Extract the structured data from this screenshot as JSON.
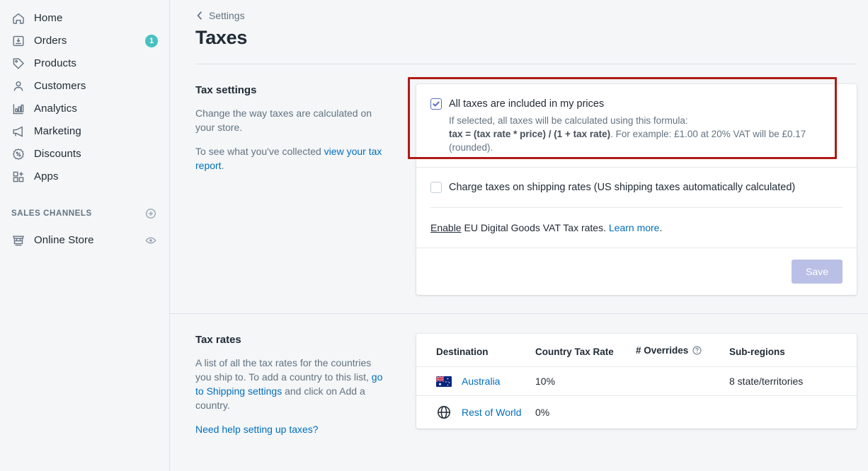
{
  "sidebar": {
    "items": [
      {
        "label": "Home",
        "icon": "home-icon",
        "badge": null
      },
      {
        "label": "Orders",
        "icon": "orders-icon",
        "badge": "1"
      },
      {
        "label": "Products",
        "icon": "products-tag-icon",
        "badge": null
      },
      {
        "label": "Customers",
        "icon": "customers-person-icon",
        "badge": null
      },
      {
        "label": "Analytics",
        "icon": "analytics-bar-chart-icon",
        "badge": null
      },
      {
        "label": "Marketing",
        "icon": "marketing-megaphone-icon",
        "badge": null
      },
      {
        "label": "Discounts",
        "icon": "discounts-percent-icon",
        "badge": null
      },
      {
        "label": "Apps",
        "icon": "apps-grid-plus-icon",
        "badge": null
      }
    ],
    "section_title": "SALES CHANNELS",
    "add_channel_icon": "plus-circle-icon",
    "channels": [
      {
        "label": "Online Store",
        "icon": "online-store-icon",
        "action_icon": "eye-icon"
      }
    ],
    "badge_color": "#47C1BF"
  },
  "header": {
    "back_label": "Settings",
    "back_icon": "chevron-left-icon",
    "title": "Taxes"
  },
  "tax_settings": {
    "title": "Tax settings",
    "desc_1": "Change the way taxes are calculated on your store.",
    "desc_2_prefix": "To see what you've collected ",
    "desc_2_link": "view your tax report",
    "desc_2_suffix": ".",
    "included_checkbox": {
      "checked": true,
      "label": "All taxes are included in my prices",
      "help_line1": "If selected, all taxes will be calculated using this formula:",
      "help_formula": "tax = (tax rate * price) / (1 + tax rate)",
      "help_line2_tail": ". For example: £1.00 at 20% VAT will be £0.17 (rounded)."
    },
    "shipping_checkbox": {
      "checked": false,
      "label": "Charge taxes on shipping rates (US shipping taxes automatically calculated)"
    },
    "eu_vat": {
      "enable_label": "Enable",
      "middle_text": " EU Digital Goods VAT Tax rates. ",
      "learn_more": "Learn more",
      "suffix": "."
    },
    "save_label": "Save",
    "save_color": "#BAC0E5"
  },
  "annotation": {
    "color": "#AF1B16"
  },
  "tax_rates": {
    "title": "Tax rates",
    "desc_prefix": "A list of all the tax rates for the countries you ship to. To add a country to this list, ",
    "desc_link": "go to Shipping settings",
    "desc_suffix": " and click on Add a country.",
    "help_link": "Need help setting up taxes?",
    "columns": [
      "Destination",
      "Country Tax Rate",
      "# Overrides",
      "Sub-regions"
    ],
    "overrides_help_icon": "question-circle-icon",
    "rows": [
      {
        "flag_icon": "flag-australia-icon",
        "destination": "Australia",
        "country_tax_rate": "10%",
        "overrides": "",
        "sub_regions": "8 state/territories"
      },
      {
        "flag_icon": "globe-icon",
        "destination": "Rest of World",
        "country_tax_rate": "0%",
        "overrides": "",
        "sub_regions": ""
      }
    ]
  }
}
